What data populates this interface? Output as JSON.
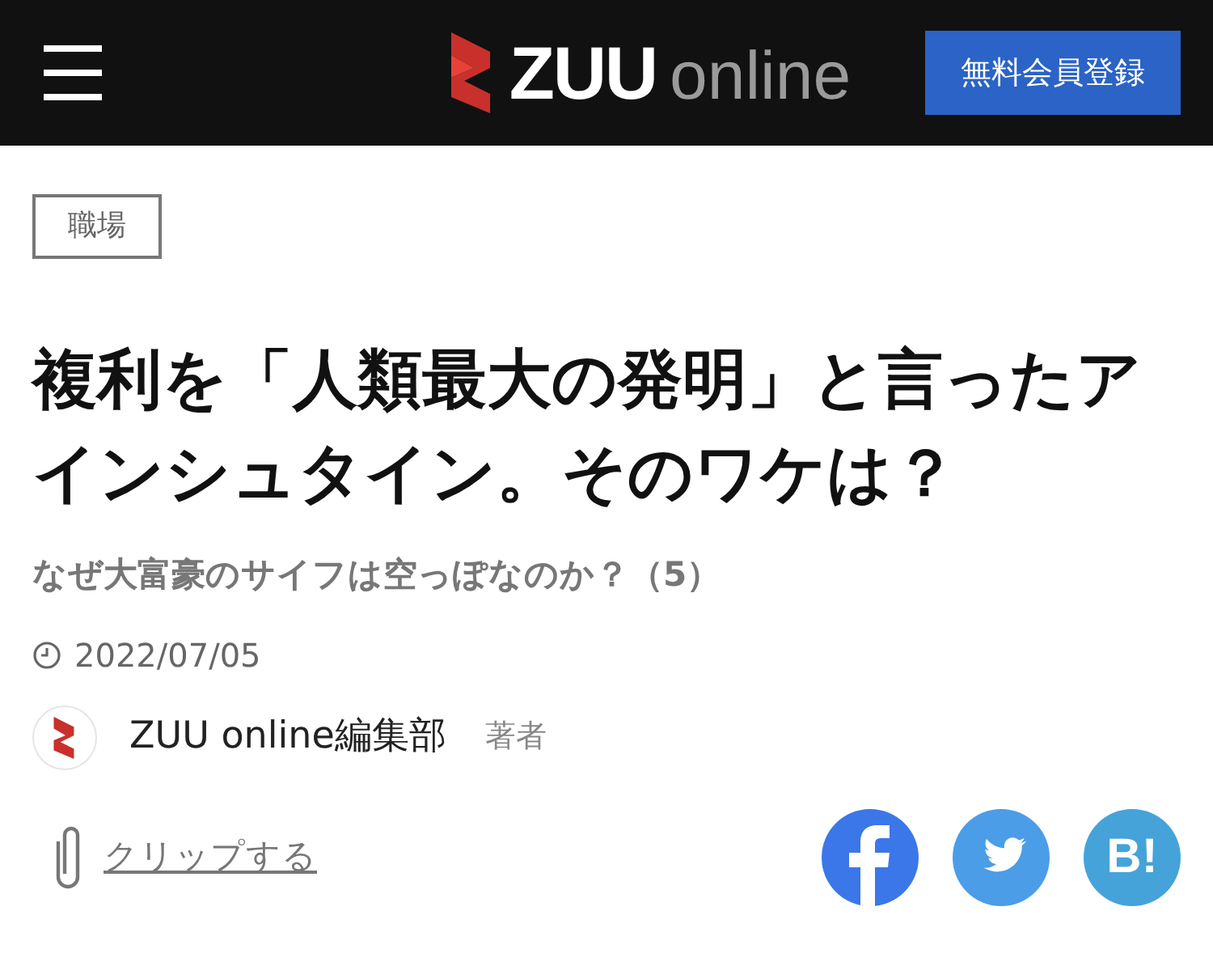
{
  "header": {
    "logo": {
      "primary": "ZUU",
      "secondary": "online"
    },
    "register_button": "無料会員登録"
  },
  "article": {
    "category": "職場",
    "title": "複利を「人類最大の発明」と言ったアインシュタイン。そのワケは？",
    "subtitle": "なぜ大富豪のサイフは空っぽなのか？（5）",
    "date": "2022/07/05",
    "author": {
      "name": "ZUU online編集部",
      "role": "著者"
    },
    "clip_link": "クリップする",
    "share_buttons": [
      {
        "kind": "facebook"
      },
      {
        "kind": "twitter"
      },
      {
        "kind": "hatena",
        "label": "B!"
      }
    ]
  }
}
